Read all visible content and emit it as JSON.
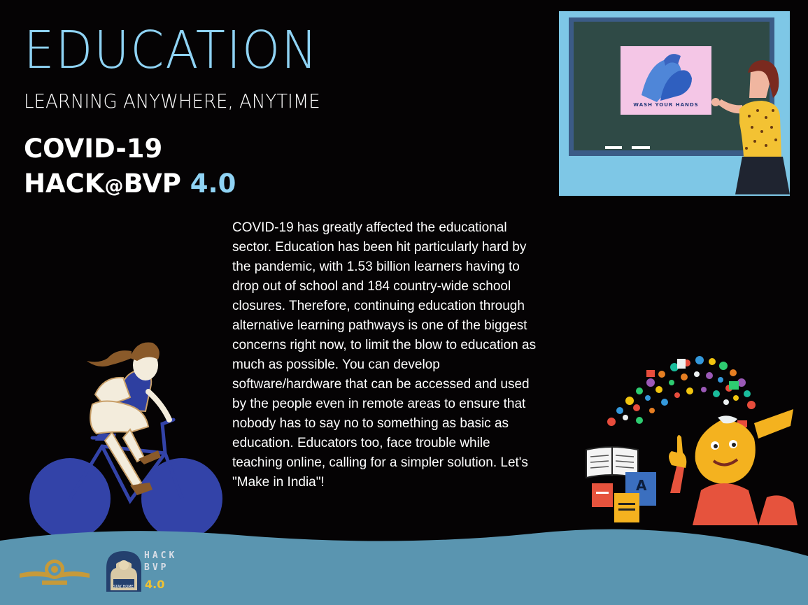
{
  "poster": {
    "title": "EDUCATION",
    "subtitle": "LEARNING ANYWHERE, ANYTIME",
    "heading_line1": "COVID-19",
    "heading_hack": "HACK",
    "heading_at": "@",
    "heading_bvp": "BVP ",
    "heading_version": "4.0",
    "body": "COVID-19 has greatly affected the educational\nsector. Education has been hit particularly hard by\nthe pandemic, with 1.53 billion learners having to\ndrop out of school and 184 country-wide school\nclosures. Therefore, continuing education through\nalternative learning pathways is one of the biggest\nconcerns right now, to limit the blow to education as\nmuch as possible. You can develop\nsoftware/hardware that can be accessed and used\nby the people even in remote areas to ensure that\nnobody has to say no to something as basic as\neducation. Educators too, face trouble while\nteaching online, calling for a simpler solution. Let's\n\"Make in India\"!"
  },
  "illustrations": {
    "chalkboard_caption": "WASH YOUR HANDS",
    "book_letter": "A"
  },
  "footer": {
    "hack_logo_line1": "HACK",
    "hack_logo_line2": "BVP",
    "hack_logo_version": "4.0",
    "stay_home": "STAY HOME"
  },
  "colors": {
    "background": "#050304",
    "accent_blue": "#8fd3f4",
    "footer_wave": "#5a95b0",
    "chalkboard": "#2f4a46",
    "bicycle_wheel": "#3343a8"
  },
  "icons": [
    "teacher-chalkboard-illustration",
    "cyclist-illustration",
    "thinking-boy-illustration",
    "college-emblem-icon",
    "hack-bvp-logo-icon"
  ]
}
